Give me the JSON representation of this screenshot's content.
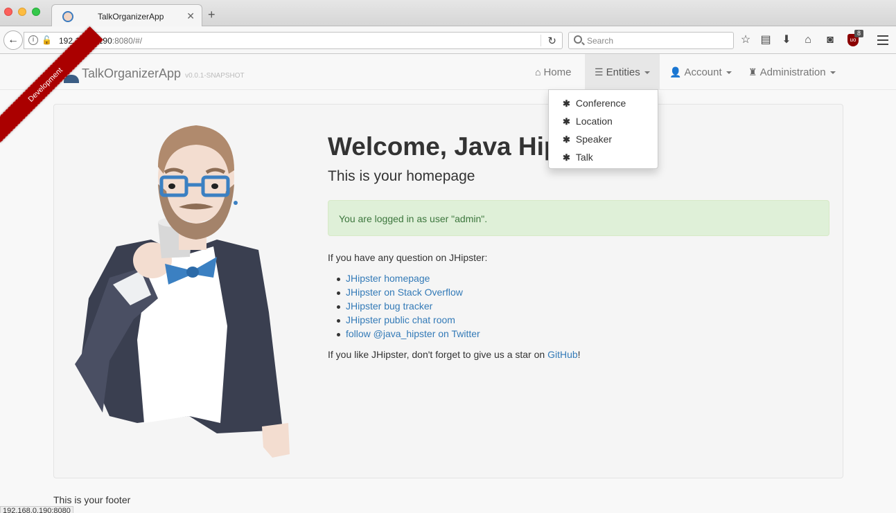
{
  "browser": {
    "tab_title": "TalkOrganizerApp",
    "url_host": "192.168.0.190",
    "url_rest": ":8080/#/",
    "search_placeholder": "Search",
    "ublock_count": "8",
    "status_url": "192.168.0.190:8080"
  },
  "app": {
    "brand": "TalkOrganizerApp",
    "version": "v0.0.1-SNAPSHOT",
    "ribbon": "Development",
    "nav": {
      "home": "Home",
      "entities": "Entities",
      "account": "Account",
      "administration": "Administration"
    },
    "entities_menu": [
      "Conference",
      "Location",
      "Speaker",
      "Talk"
    ]
  },
  "main": {
    "title": "Welcome, Java Hip",
    "subtitle": "This is your homepage",
    "alert": "You are logged in as user \"admin\".",
    "question": "If you have any question on JHipster:",
    "links": [
      "JHipster homepage",
      "JHipster on Stack Overflow",
      "JHipster bug tracker",
      "JHipster public chat room",
      "follow @java_hipster on Twitter"
    ],
    "github_prefix": "If you like JHipster, don't forget to give us a star on ",
    "github_link": "GitHub",
    "github_suffix": "!"
  },
  "footer": "This is your footer",
  "colors": {
    "link": "#337ab7",
    "alert_bg": "#dff0d8",
    "alert_text": "#3c763d",
    "ribbon": "#aa0000"
  }
}
